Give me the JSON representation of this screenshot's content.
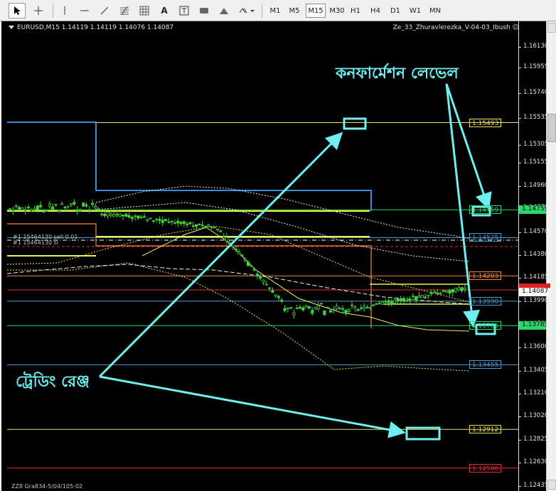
{
  "toolbar": {
    "timeframes": [
      "M1",
      "M5",
      "M15",
      "M30",
      "H1",
      "H4",
      "D1",
      "W1",
      "MN"
    ],
    "active_timeframe": "M15",
    "tools": [
      "cursor",
      "crosshair",
      "vertical-line",
      "horizontal-line",
      "trendline",
      "fibonacci",
      "grid",
      "text",
      "text-label",
      "rectangle",
      "triangle",
      "arrows"
    ]
  },
  "chart": {
    "symbol_info": "EURUSD,M15  1.14119 1.14119 1.14076 1.14087",
    "ea_name": "Ze_33_Zhuravlerezka_V-04-03_Ibush",
    "ea_status_icon": "smiley-icon",
    "order_note_1": "#1 15464130 sell 0.01",
    "order_note_2": "#1 15464130 sl",
    "bottom_note": "ZZ8 Gra834-5/04/105-02",
    "axis_ticks": [
      "1.16130",
      "1.15955",
      "1.15740",
      "1.15535",
      "1.15305",
      "1.15155",
      "1.14960",
      "1.14775",
      "1.14570",
      "1.14380",
      "1.14185",
      "1.13990",
      "1.13790",
      "1.13600",
      "1.13405",
      "1.13210",
      "1.13020",
      "1.12825",
      "1.12630",
      "1.12435"
    ],
    "levels": [
      {
        "price": "1.15493",
        "color": "#f0e060",
        "tag_color": "#f0e060"
      },
      {
        "price": "1.14759",
        "color": "#2bd66a",
        "tag_color": "#2bd66a"
      },
      {
        "price": "1.14525",
        "color": "#4a9bd0",
        "tag_color": "#4a9bd0"
      },
      {
        "price": "1.14203",
        "color": "#f08a40",
        "tag_color": "#f08a40"
      },
      {
        "price": "1.13990",
        "color": "#4a9bd0",
        "tag_color": "#4a9bd0"
      },
      {
        "price": "1.13785",
        "color": "#2bd66a",
        "tag_color": "#2bd66a"
      },
      {
        "price": "1.13455",
        "color": "#4a9bd0",
        "tag_color": "#4a9bd0"
      },
      {
        "price": "1.12912",
        "color": "#f0e060",
        "tag_color": "#f0e060"
      },
      {
        "price": "1.12586",
        "color": "#e03030",
        "tag_color": "#e03030"
      }
    ],
    "current_price": "1.14087",
    "red_marker_price": ""
  },
  "annotations": {
    "confirmation_level": "কনফার্মেশন লেভেল",
    "trading_range": "ট্রেডিং রেঞ্জ",
    "color": "#6ef0f0"
  }
}
